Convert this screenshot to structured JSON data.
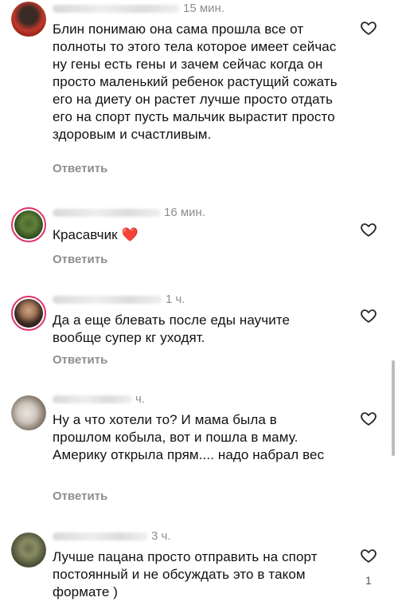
{
  "reply_label": "Ответить",
  "comments": [
    {
      "time": "15 мин.",
      "text": "Блин понимаю она сама прошла все от полноты то этого тела которое имеет сейчас ну гены есть гены и зачем сейчас когда он просто маленький ребенок растущий сожать его на диету он растет лучше просто отдать его на спорт пусть мальчик вырастит просто здоровым и счастливым."
    },
    {
      "time": "16 мин.",
      "text": "Красавчик",
      "emoji": "❤️"
    },
    {
      "time": "1 ч.",
      "text": "Да а еще блевать после еды научите вообще супер кг уходят."
    },
    {
      "time": "ч.",
      "text": "Ну а что хотели то? И мама была в прошлом кобыла, вот и пошла в маму. Америку открыла прям.... надо набрал вес"
    },
    {
      "time": "3 ч.",
      "text": "Лучше пацана просто отправить на спорт постоянный и не обсуждать это в таком формате )",
      "likes": "1"
    }
  ],
  "colors": {
    "heart": "#e0252a",
    "secondary_text": "#8e8e8e",
    "story_ring": "#e1306c"
  }
}
